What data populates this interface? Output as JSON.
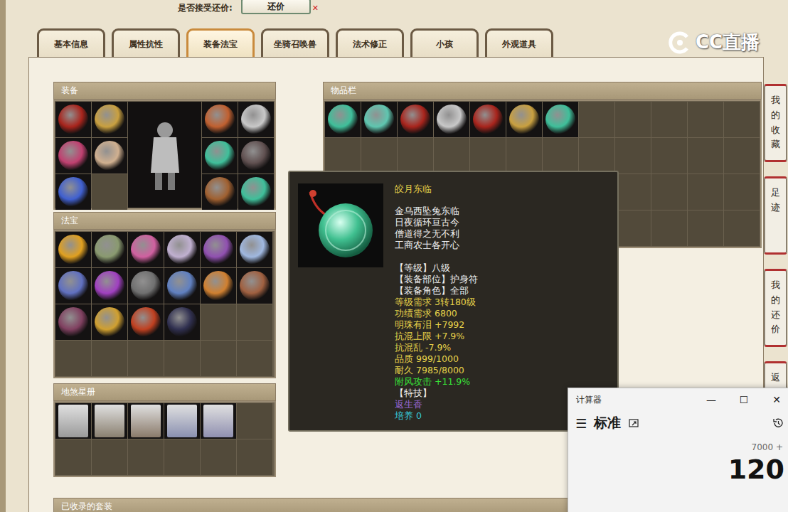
{
  "top_bar": {
    "label": "是否接受还价:",
    "button": "还价",
    "close": "✕"
  },
  "tabs": [
    {
      "label": "基本信息",
      "selected": false
    },
    {
      "label": "属性抗性",
      "selected": false
    },
    {
      "label": "装备法宝",
      "selected": true
    },
    {
      "label": "坐骑召唤兽",
      "selected": false
    },
    {
      "label": "法术修正",
      "selected": false
    },
    {
      "label": "小孩",
      "selected": false
    },
    {
      "label": "外观道具",
      "selected": false
    }
  ],
  "logo": {
    "text": "CC直播"
  },
  "equipment": {
    "title": "装备",
    "left_slots": [
      {
        "filled": true,
        "color": "#a8241c"
      },
      {
        "filled": true,
        "color": "#c9a040"
      },
      {
        "filled": true,
        "color": "#c04070"
      },
      {
        "filled": true,
        "color": "#d0b090"
      },
      {
        "filled": true,
        "color": "#4060d0"
      },
      {
        "filled": false
      }
    ],
    "right_slots": [
      {
        "filled": true,
        "color": "#c06030"
      },
      {
        "filled": true,
        "color": "#c8c8c8"
      },
      {
        "filled": true,
        "color": "#3fbf9a"
      },
      {
        "filled": true,
        "color": "#605050"
      },
      {
        "filled": true,
        "color": "#a06030"
      },
      {
        "filled": true,
        "color": "#3fbf9a"
      }
    ]
  },
  "treasures": {
    "title": "法宝",
    "slots": [
      {
        "filled": true,
        "color": "#e0a020"
      },
      {
        "filled": true,
        "color": "#8a9a70"
      },
      {
        "filled": true,
        "color": "#d060a0"
      },
      {
        "filled": true,
        "color": "#c0b0d0"
      },
      {
        "filled": true,
        "color": "#9050b0"
      },
      {
        "filled": true,
        "color": "#a0b8e0"
      },
      {
        "filled": true,
        "color": "#6070c0"
      },
      {
        "filled": true,
        "color": "#a040c0"
      },
      {
        "filled": true,
        "color": "#707070"
      },
      {
        "filled": true,
        "color": "#6080c0"
      },
      {
        "filled": true,
        "color": "#d08030"
      },
      {
        "filled": true,
        "color": "#a06040"
      },
      {
        "filled": true,
        "color": "#804060"
      },
      {
        "filled": true,
        "color": "#d0a030"
      },
      {
        "filled": true,
        "color": "#c04020"
      },
      {
        "filled": true,
        "color": "#303050"
      },
      {
        "filled": false
      },
      {
        "filled": false
      },
      {
        "filled": false
      },
      {
        "filled": false
      },
      {
        "filled": false
      },
      {
        "filled": false
      },
      {
        "filled": false
      },
      {
        "filled": false
      }
    ]
  },
  "star_book": {
    "title": "地煞星册",
    "slots": [
      {
        "filled": true,
        "color": "#9a9a9a"
      },
      {
        "filled": true,
        "color": "#8a8070"
      },
      {
        "filled": true,
        "color": "#8a7a6a"
      },
      {
        "filled": true,
        "color": "#8a90b0"
      },
      {
        "filled": true,
        "color": "#9090b0"
      },
      {
        "filled": false
      },
      {
        "filled": false
      },
      {
        "filled": false
      },
      {
        "filled": false
      },
      {
        "filled": false
      },
      {
        "filled": false
      },
      {
        "filled": false
      }
    ]
  },
  "inventory": {
    "title": "物品栏",
    "slots": [
      {
        "filled": true,
        "color": "#3fbf9a"
      },
      {
        "filled": true,
        "color": "#5fc6b0"
      },
      {
        "filled": true,
        "color": "#a8241c"
      },
      {
        "filled": true,
        "color": "#c8c8c8"
      },
      {
        "filled": true,
        "color": "#a8241c"
      },
      {
        "filled": true,
        "color": "#c9a040"
      },
      {
        "filled": true,
        "color": "#3fbf9a"
      },
      {
        "filled": false
      },
      {
        "filled": false
      },
      {
        "filled": false
      },
      {
        "filled": false
      },
      {
        "filled": false
      },
      {
        "filled": false
      },
      {
        "filled": false
      },
      {
        "filled": false
      },
      {
        "filled": false
      },
      {
        "filled": false
      },
      {
        "filled": false
      },
      {
        "filled": false
      },
      {
        "filled": false
      },
      {
        "filled": false
      },
      {
        "filled": false
      },
      {
        "filled": false
      },
      {
        "filled": false
      },
      {
        "filled": false
      },
      {
        "filled": false
      },
      {
        "filled": false
      },
      {
        "filled": false
      },
      {
        "filled": false
      },
      {
        "filled": false
      },
      {
        "filled": false
      },
      {
        "filled": false
      },
      {
        "filled": false
      },
      {
        "filled": false
      },
      {
        "filled": false
      },
      {
        "filled": false
      },
      {
        "filled": false
      },
      {
        "filled": false
      },
      {
        "filled": false
      },
      {
        "filled": false
      },
      {
        "filled": false
      },
      {
        "filled": false
      },
      {
        "filled": false
      },
      {
        "filled": false
      },
      {
        "filled": false
      },
      {
        "filled": false
      },
      {
        "filled": false
      },
      {
        "filled": false
      }
    ]
  },
  "suits": {
    "title": "已收录的套装"
  },
  "side_tabs": [
    {
      "label": "我的收藏"
    },
    {
      "label": "足迹"
    },
    {
      "label": "我的还价"
    },
    {
      "label": "返"
    }
  ],
  "tooltip": {
    "name": "皎月东临",
    "name_color": "#e8d44a",
    "poem": [
      "金乌西坠兔东临",
      "日夜循环亘古今",
      "僧道得之无不利",
      "工商农士各开心"
    ],
    "lines": [
      {
        "text": "【等级】八级",
        "color": "#f0f0f0"
      },
      {
        "text": "【装备部位】护身符",
        "color": "#f0f0f0"
      },
      {
        "text": "【装备角色】全部",
        "color": "#f0f0f0"
      },
      {
        "text": "等级需求 3转180级",
        "color": "#e8d44a"
      },
      {
        "text": "功绩需求 6800",
        "color": "#e8d44a"
      },
      {
        "text": "明珠有泪 +7992",
        "color": "#e8d44a"
      },
      {
        "text": "抗混上限 +7.9%",
        "color": "#e8d44a"
      },
      {
        "text": "抗混乱 -7.9%",
        "color": "#e8d44a"
      },
      {
        "text": "品质 999/1000",
        "color": "#e8d44a"
      },
      {
        "text": "耐久 7985/8000",
        "color": "#e8d44a"
      },
      {
        "text": "附风攻击 +11.9%",
        "color": "#38e038"
      },
      {
        "text": "【特技】",
        "color": "#f0f0f0"
      },
      {
        "text": "返生香",
        "color": "#9a6ad8"
      },
      {
        "text": "培养 0",
        "color": "#36c8d8"
      }
    ]
  },
  "calculator": {
    "title": "计算器",
    "controls": [
      "—",
      "☐",
      "✕"
    ],
    "menu": "☰",
    "mode": "标准",
    "history": "7000 +",
    "display": "120"
  }
}
